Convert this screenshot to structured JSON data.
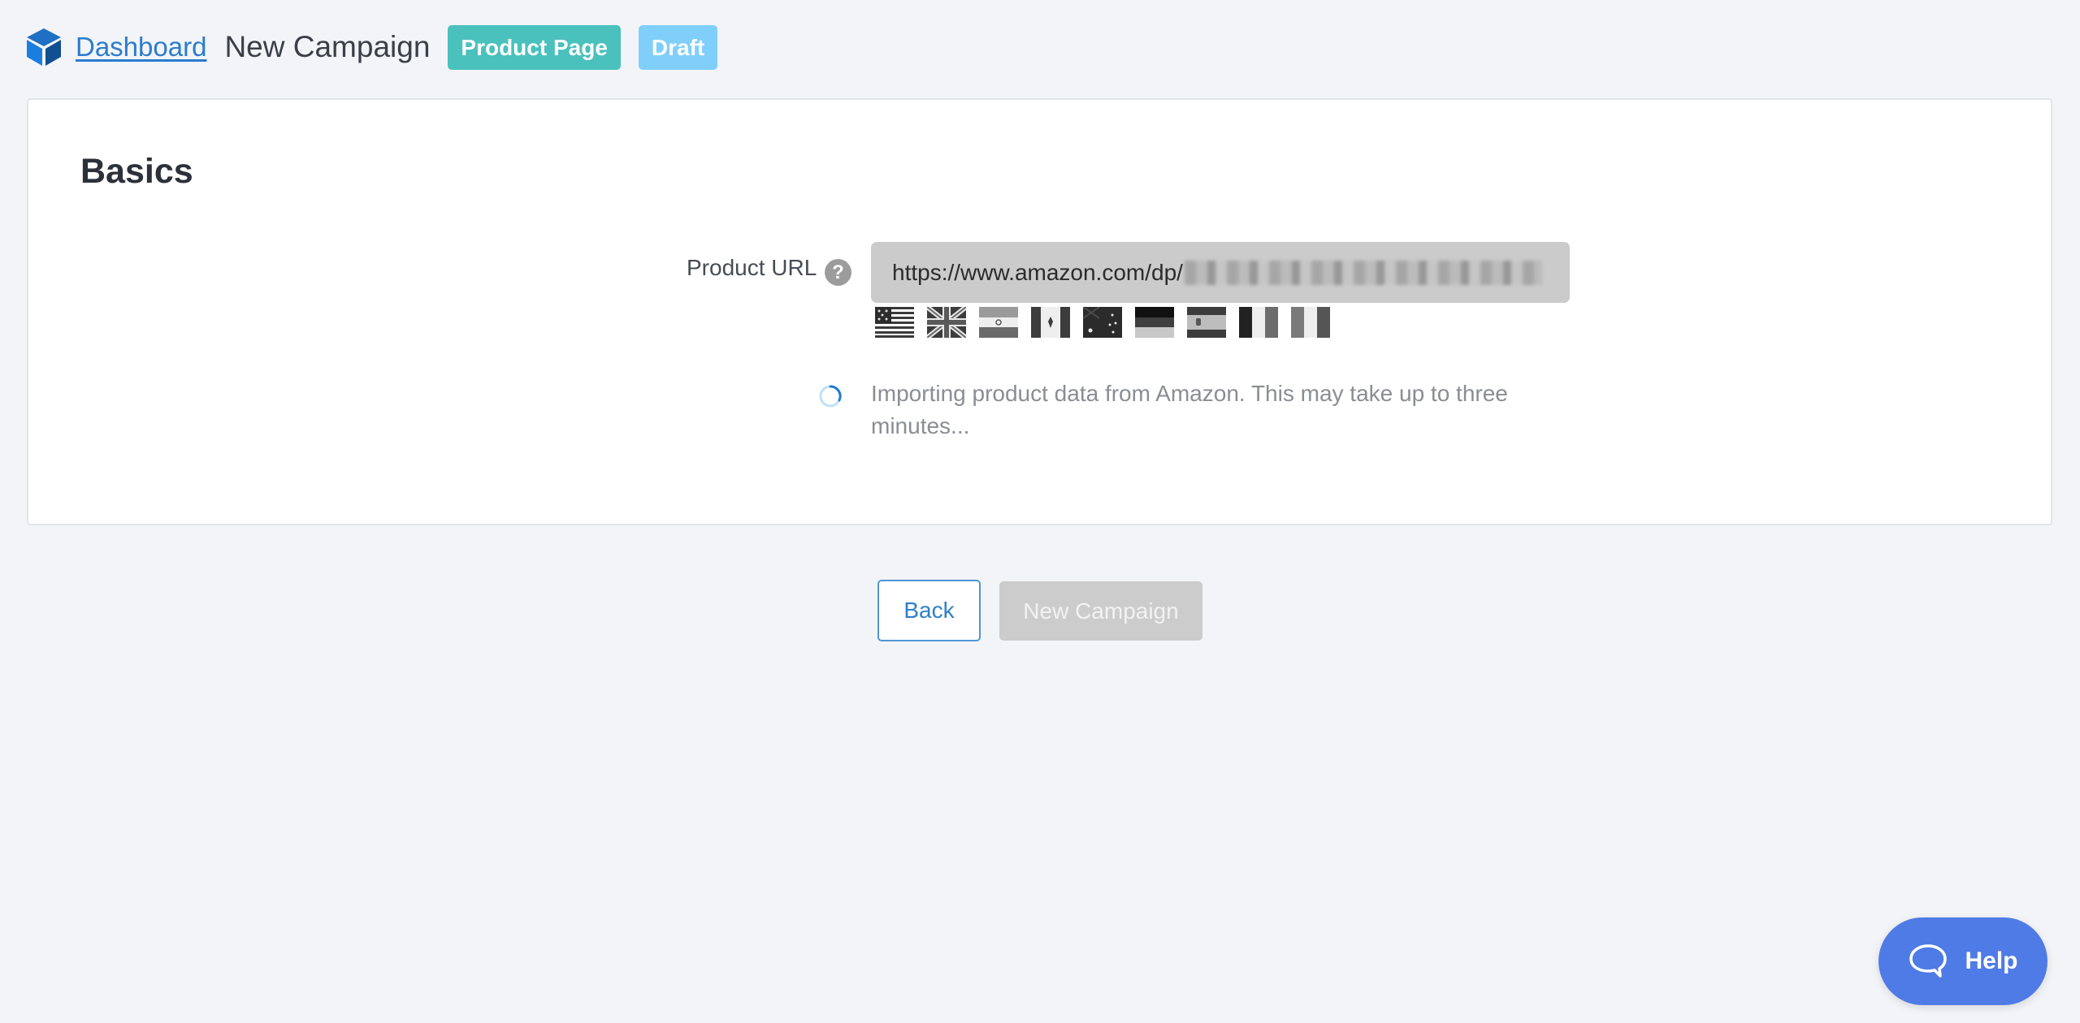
{
  "header": {
    "logo_icon": "cube-logo-icon",
    "breadcrumb_link": "Dashboard",
    "page_title": "New Campaign",
    "badges": [
      {
        "label": "Product Page",
        "color": "#4ac1bd"
      },
      {
        "label": "Draft",
        "color": "#7fcffa"
      }
    ]
  },
  "card": {
    "title": "Basics",
    "product_url": {
      "label": "Product URL",
      "help_icon": "question-circle-icon",
      "help_glyph": "?",
      "value_visible": "https://www.amazon.com/dp/",
      "value_obscured": true
    },
    "marketplaces": [
      {
        "code": "US",
        "name": "United States"
      },
      {
        "code": "UK",
        "name": "United Kingdom"
      },
      {
        "code": "IN",
        "name": "India"
      },
      {
        "code": "CA",
        "name": "Canada"
      },
      {
        "code": "AU",
        "name": "Australia"
      },
      {
        "code": "DE",
        "name": "Germany"
      },
      {
        "code": "ES",
        "name": "Spain"
      },
      {
        "code": "FR",
        "name": "France"
      },
      {
        "code": "IT",
        "name": "Italy"
      }
    ],
    "status": {
      "icon": "loading-spinner-icon",
      "message": "Importing product data from Amazon. This may take up to three minutes..."
    }
  },
  "actions": {
    "back_label": "Back",
    "new_campaign_label": "New Campaign",
    "new_campaign_disabled": true
  },
  "help_widget": {
    "icon": "chat-bubble-icon",
    "label": "Help",
    "color": "#4f7be6"
  },
  "colors": {
    "accent": "#2a7ccd",
    "background": "#f3f4f7"
  }
}
